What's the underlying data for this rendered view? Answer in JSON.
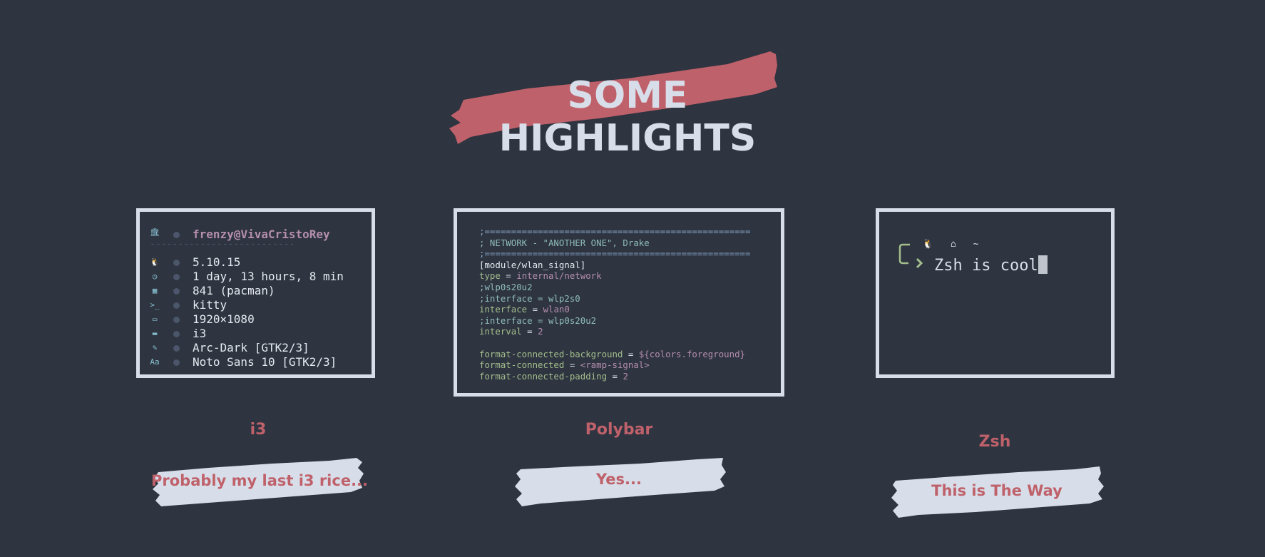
{
  "title": "SOME HIGHLIGHTS",
  "colors": {
    "background": "#2e3440",
    "accent_red": "#bf616a",
    "light": "#d8dee9",
    "brush_light": "#d8dee9"
  },
  "neofetch": {
    "user": "frenzy",
    "at": "@",
    "host": "VivaCristoRey",
    "separator": "--------------------------",
    "rows": [
      {
        "icon": "linux-icon",
        "glyph": "🐧",
        "text": "5.10.15"
      },
      {
        "icon": "clock-icon",
        "glyph": "◷",
        "text": "1 day, 13 hours, 8 min"
      },
      {
        "icon": "package-icon",
        "glyph": "▦",
        "text": "841 (pacman)"
      },
      {
        "icon": "terminal-icon",
        "glyph": ">_",
        "text": "kitty"
      },
      {
        "icon": "monitor-icon",
        "glyph": "▭",
        "text": "1920×1080"
      },
      {
        "icon": "window-icon",
        "glyph": "▬",
        "text": "i3"
      },
      {
        "icon": "brush-icon",
        "glyph": "✎",
        "text": "Arc-Dark [GTK2/3]"
      },
      {
        "icon": "font-icon",
        "glyph": "Aa",
        "text": "Noto Sans 10 [GTK2/3]"
      }
    ],
    "home_icon": "bank-icon"
  },
  "polybar": {
    "lines": [
      {
        "parts": [
          {
            "t": ";==================================================",
            "c": "c-dim"
          }
        ]
      },
      {
        "parts": [
          {
            "t": "; NETWORK - \"ANOTHER ONE\", Drake",
            "c": "c-comment"
          }
        ]
      },
      {
        "parts": [
          {
            "t": ";==================================================",
            "c": "c-dim"
          }
        ]
      },
      {
        "parts": [
          {
            "t": "[module/wlan_signal]",
            "c": "c-sec"
          }
        ]
      },
      {
        "parts": [
          {
            "t": "type",
            "c": "c-key"
          },
          {
            "t": " = ",
            "c": "c-plain"
          },
          {
            "t": "internal/network",
            "c": "c-val"
          }
        ]
      },
      {
        "parts": [
          {
            "t": ";wlp0s20u2",
            "c": "c-comment"
          }
        ]
      },
      {
        "parts": [
          {
            "t": ";interface = wlp2s0",
            "c": "c-comment"
          }
        ]
      },
      {
        "parts": [
          {
            "t": "interface",
            "c": "c-key"
          },
          {
            "t": " = ",
            "c": "c-plain"
          },
          {
            "t": "wlan0",
            "c": "c-val"
          }
        ]
      },
      {
        "parts": [
          {
            "t": ";interface = wlp0s20u2",
            "c": "c-comment"
          }
        ]
      },
      {
        "parts": [
          {
            "t": "interval",
            "c": "c-key"
          },
          {
            "t": " = ",
            "c": "c-plain"
          },
          {
            "t": "2",
            "c": "c-val"
          }
        ]
      },
      {
        "parts": []
      },
      {
        "parts": [
          {
            "t": "format-connected-background",
            "c": "c-key"
          },
          {
            "t": " = ",
            "c": "c-plain"
          },
          {
            "t": "${colors.foreground}",
            "c": "c-val"
          }
        ]
      },
      {
        "parts": [
          {
            "t": "format-connected",
            "c": "c-key"
          },
          {
            "t": " = ",
            "c": "c-plain"
          },
          {
            "t": "<ramp-signal>",
            "c": "c-val"
          }
        ]
      },
      {
        "parts": [
          {
            "t": "format-connected-padding",
            "c": "c-key"
          },
          {
            "t": " = ",
            "c": "c-plain"
          },
          {
            "t": "2",
            "c": "c-val"
          }
        ]
      }
    ]
  },
  "zsh": {
    "icons": "🐧 ⌂ ~",
    "command": "Zsh is cool"
  },
  "cards": [
    {
      "label": "i3",
      "caption": "Probably my last i3 rice..."
    },
    {
      "label": "Polybar",
      "caption": "Yes..."
    },
    {
      "label": "Zsh",
      "caption": "This is The Way"
    }
  ]
}
